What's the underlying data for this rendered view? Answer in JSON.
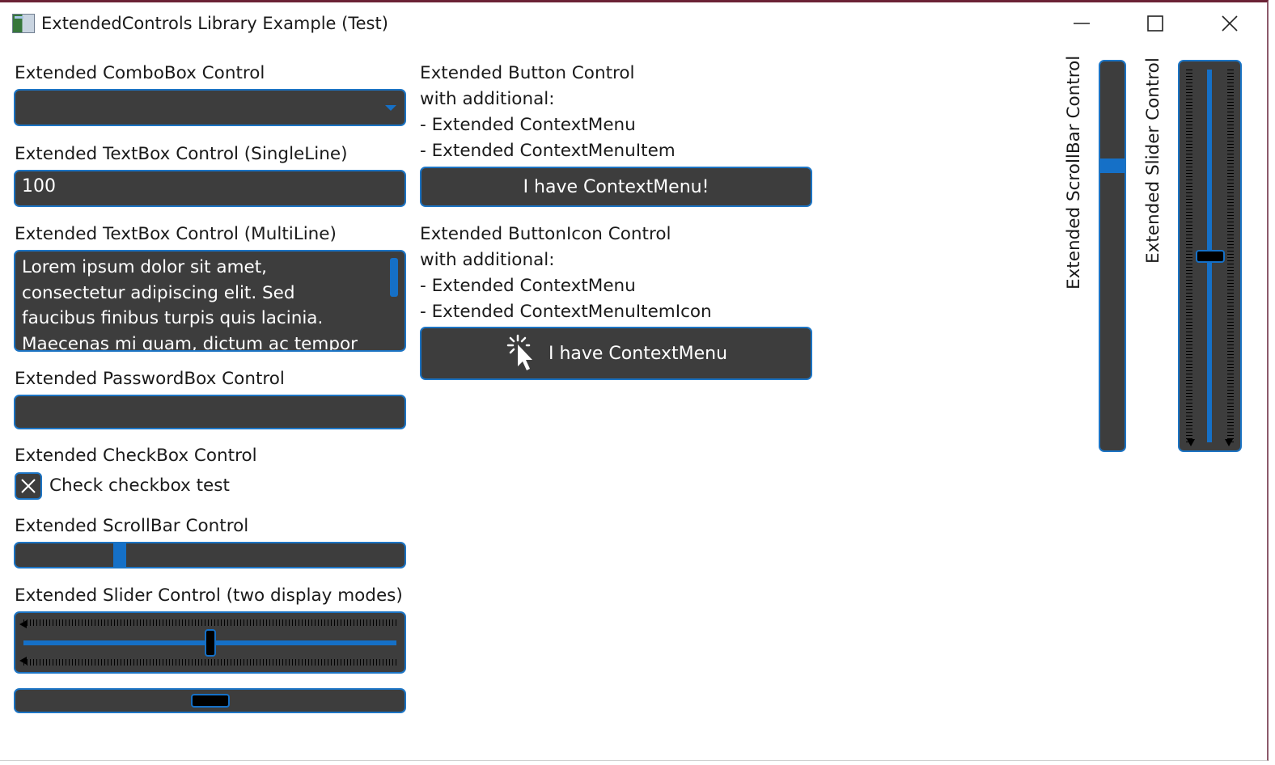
{
  "window": {
    "title": "ExtendedControls Library Example (Test)",
    "icons": {
      "app": "app-window-icon",
      "minimize": "minimize-icon",
      "maximize": "maximize-icon",
      "close": "close-icon"
    }
  },
  "combobox": {
    "label": "Extended ComboBox Control",
    "value": "",
    "icon": "chevron-down-icon"
  },
  "textbox_single": {
    "label": "Extended TextBox Control (SingleLine)",
    "value": "100"
  },
  "textbox_multi": {
    "label": "Extended TextBox Control (MultiLine)",
    "value": "Lorem ipsum dolor sit amet, consectetur adipiscing elit. Sed faucibus finibus turpis quis lacinia. Maecenas mi quam, dictum ac tempor a, euismod ut tortor. Cras nec"
  },
  "passwordbox": {
    "label": "Extended PasswordBox Control",
    "value": ""
  },
  "checkbox": {
    "label": "Extended CheckBox Control",
    "text": "Check checkbox test",
    "checked": true,
    "icon": "x-mark-icon"
  },
  "scrollbar_h": {
    "label": "Extended ScrollBar Control",
    "position": 0.26
  },
  "slider_h": {
    "label": "Extended Slider Control (two display modes)",
    "value": 0.5,
    "compact_value": 0.5
  },
  "button": {
    "description": [
      "Extended Button Control",
      "with additional:",
      "- Extended ContextMenu",
      "- Extended ContextMenuItem"
    ],
    "text": "I have ContextMenu!"
  },
  "button_icon": {
    "description": [
      "Extended ButtonIcon Control",
      "with additional:",
      "- Extended ContextMenu",
      "- Extended ContextMenuItemIcon"
    ],
    "text": "I have ContextMenu",
    "icon": "cursor-click-icon"
  },
  "scrollbar_v": {
    "label": "Extended ScrollBar Control",
    "position": 0.26
  },
  "slider_v": {
    "label": "Extended Slider Control",
    "value": 0.5
  },
  "colors": {
    "accent": "#1570c7",
    "control_bg": "#3d3d3d",
    "border": "#1c74c4",
    "titlebar_accent": "#6b2235"
  }
}
